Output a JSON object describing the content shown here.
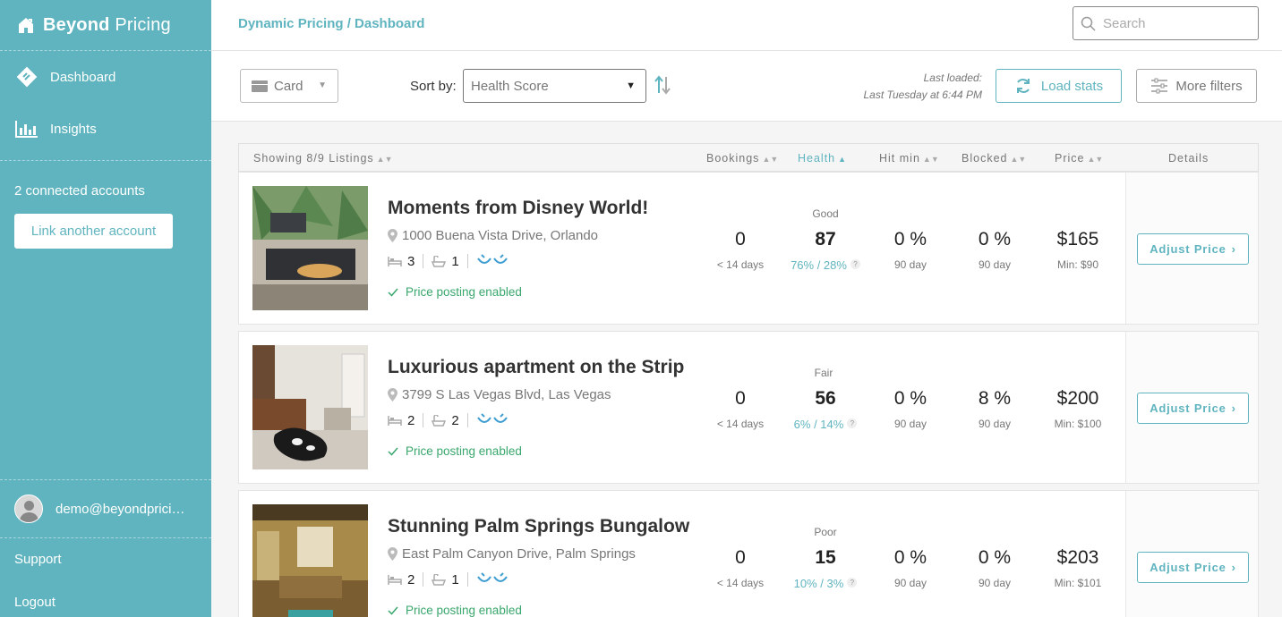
{
  "brand": {
    "name_bold": "Beyond",
    "name_light": "Pricing"
  },
  "sidebar": {
    "nav": [
      {
        "label": "Dashboard",
        "icon": "tag-icon"
      },
      {
        "label": "Insights",
        "icon": "bar-chart-icon"
      }
    ],
    "accounts_text": "2 connected accounts",
    "link_account_label": "Link another account",
    "user_email": "demo@beyondpricing.com",
    "support_label": "Support",
    "logout_label": "Logout"
  },
  "header": {
    "breadcrumb": "Dynamic Pricing / Dashboard",
    "search_placeholder": "Search"
  },
  "toolbar": {
    "view_value": "Card",
    "sort_label": "Sort by:",
    "sort_value": "Health Score",
    "last_loaded_label": "Last loaded:",
    "last_loaded_value": "Last Tuesday at 6:44 PM",
    "load_stats_label": "Load stats",
    "more_filters_label": "More filters"
  },
  "table": {
    "headers": {
      "showing": "Showing 8/9 Listings",
      "bookings": "Bookings",
      "health": "Health",
      "hit_min": "Hit min",
      "blocked": "Blocked",
      "price": "Price",
      "details": "Details"
    },
    "listings": [
      {
        "title": "Moments from Disney World!",
        "address": "1000 Buena Vista Drive, Orlando",
        "bedrooms": "3",
        "bathrooms": "1",
        "posting": "Price posting enabled",
        "bookings": "0",
        "bookings_sub": "< 14 days",
        "health_label": "Good",
        "health_score": "87",
        "health_sub": "76% / 28%",
        "hit_min": "0 %",
        "hit_min_sub": "90 day",
        "blocked": "0 %",
        "blocked_sub": "90 day",
        "price": "$165",
        "price_min": "Min: $90",
        "adjust_label": "Adjust Price"
      },
      {
        "title": "Luxurious apartment on the Strip",
        "address": "3799 S Las Vegas Blvd, Las Vegas",
        "bedrooms": "2",
        "bathrooms": "2",
        "posting": "Price posting enabled",
        "bookings": "0",
        "bookings_sub": "< 14 days",
        "health_label": "Fair",
        "health_score": "56",
        "health_sub": "6% / 14%",
        "hit_min": "0 %",
        "hit_min_sub": "90 day",
        "blocked": "8 %",
        "blocked_sub": "90 day",
        "price": "$200",
        "price_min": "Min: $100",
        "adjust_label": "Adjust Price"
      },
      {
        "title": "Stunning Palm Springs Bungalow",
        "address": "East Palm Canyon Drive, Palm Springs",
        "bedrooms": "2",
        "bathrooms": "1",
        "posting": "Price posting enabled",
        "bookings": "0",
        "bookings_sub": "< 14 days",
        "health_label": "Poor",
        "health_score": "15",
        "health_sub": "10% / 3%",
        "hit_min": "0 %",
        "hit_min_sub": "90 day",
        "blocked": "0 %",
        "blocked_sub": "90 day",
        "price": "$203",
        "price_min": "Min: $101",
        "adjust_label": "Adjust Price"
      }
    ]
  },
  "colors": {
    "accent": "#5fb4bf",
    "success": "#3aa76d"
  }
}
